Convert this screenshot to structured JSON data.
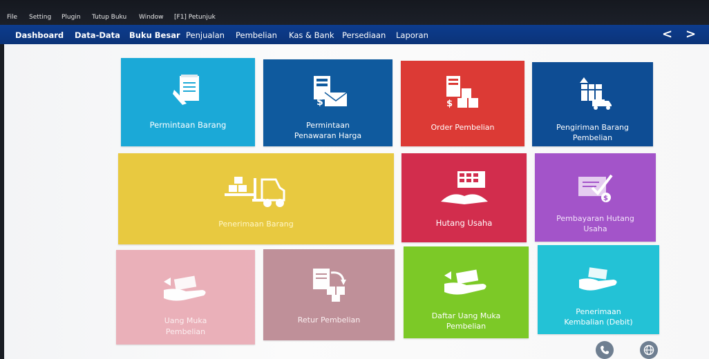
{
  "menubar": {
    "items": [
      "File",
      "Setting",
      "Plugin",
      "Tutup Buku",
      "Window",
      "[F1] Petunjuk"
    ]
  },
  "nav": {
    "tabs": [
      "Dashboard",
      "Data-Data",
      "Buku Besar",
      "Penjualan",
      "Pembelian",
      "Kas & Bank",
      "Persediaan",
      "Laporan"
    ],
    "active": "Pembelian",
    "prev": "<",
    "next": ">"
  },
  "tiles": [
    {
      "label": "Permintaan Barang",
      "icon": "request-form-icon",
      "color": "#1ba9d7"
    },
    {
      "label": "Permintaan Penawaran Harga",
      "line1": "Permintaan",
      "line2": "Penawaran Harga",
      "icon": "quotation-envelope-icon",
      "color": "#0f5a9e"
    },
    {
      "label": "Order Pembelian",
      "icon": "purchase-order-icon",
      "color": "#dc3a35"
    },
    {
      "label": "Pengiriman Barang Pembelian",
      "line1": "Pengiriman Barang",
      "line2": "Pembelian",
      "icon": "delivery-truck-icon",
      "color": "#0e4d94"
    },
    {
      "label": "Penerimaan Barang",
      "icon": "forklift-icon",
      "color": "#e8c940"
    },
    {
      "label": "Hutang Usaha",
      "icon": "ledger-book-icon",
      "color": "#d22d4d"
    },
    {
      "label": "Pembayaran Hutang Usaha",
      "line1": "Pembayaran Hutang",
      "line2": "Usaha",
      "icon": "payment-check-icon",
      "color": "#a354c9"
    },
    {
      "label": "Uang Muka Pembelian",
      "line1": "Uang Muka",
      "line2": "Pembelian",
      "icon": "hand-money-icon",
      "color": "#e9a9b3"
    },
    {
      "label": "Retur Pembelian",
      "icon": "return-goods-icon",
      "color": "#b9858f"
    },
    {
      "label": "Daftar Uang Muka Pembelian",
      "line1": "Daftar Uang Muka",
      "line2": "Pembelian",
      "icon": "hand-money-icon",
      "color": "#7cc927"
    },
    {
      "label": "Penerimaan Kembalian (Debit)",
      "line1": "Penerimaan",
      "line2": "Kembalian (Debit)",
      "icon": "hand-refund-icon",
      "color": "#23c2d6"
    }
  ],
  "footer": {
    "phone_icon": "phone-icon",
    "globe_icon": "globe-icon"
  }
}
